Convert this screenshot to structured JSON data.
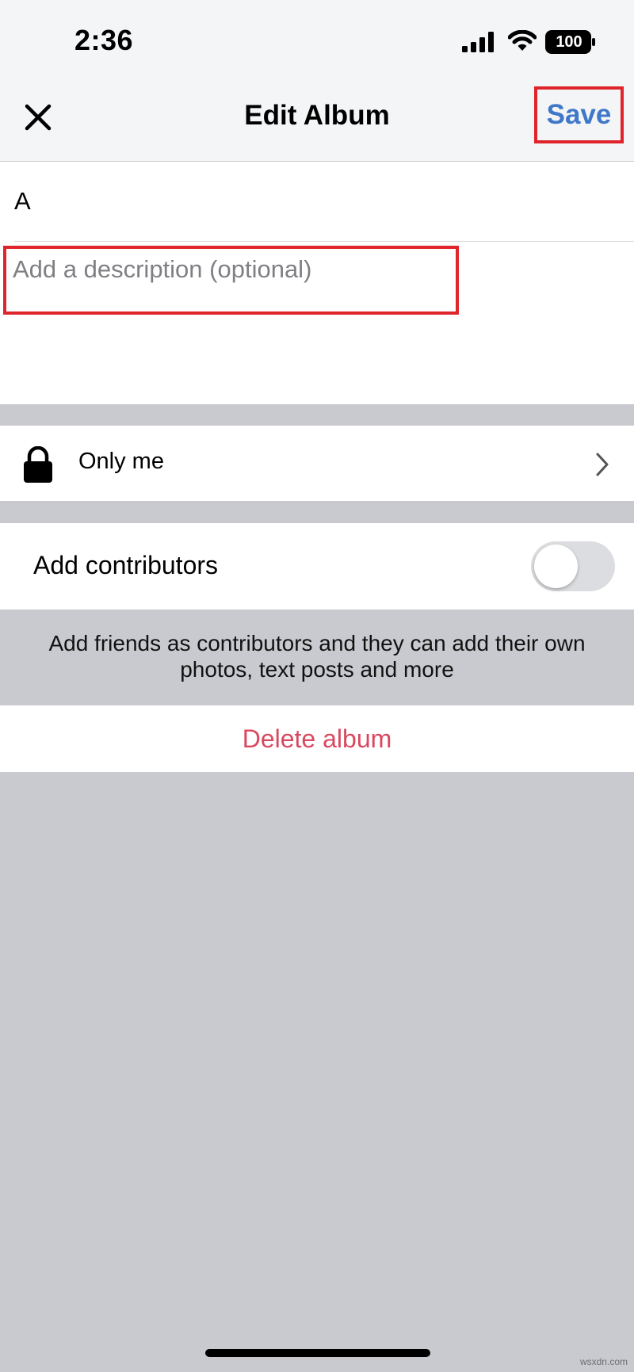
{
  "status_bar": {
    "time": "2:36",
    "battery": "100",
    "icons": [
      "signal-icon",
      "wifi-icon",
      "battery-icon"
    ]
  },
  "nav": {
    "close_icon": "close-icon",
    "title": "Edit Album",
    "save_label": "Save"
  },
  "album": {
    "name": "A",
    "description_placeholder": "Add a description (optional)",
    "description_value": ""
  },
  "privacy": {
    "icon": "lock-icon",
    "label": "Only me",
    "chevron": "chevron-right-icon"
  },
  "contributors": {
    "label": "Add contributors",
    "toggle_on": false,
    "helper": "Add friends as contributors and they can add their own photos, text posts and more"
  },
  "delete": {
    "label": "Delete album"
  },
  "watermark": "wsxdn.com",
  "colors": {
    "accent_blue": "#3f78c8",
    "delete_red": "#d9485f",
    "highlight_red": "#e0242c",
    "background_gray": "#c8cacf",
    "nav_background": "#f4f5f7"
  }
}
